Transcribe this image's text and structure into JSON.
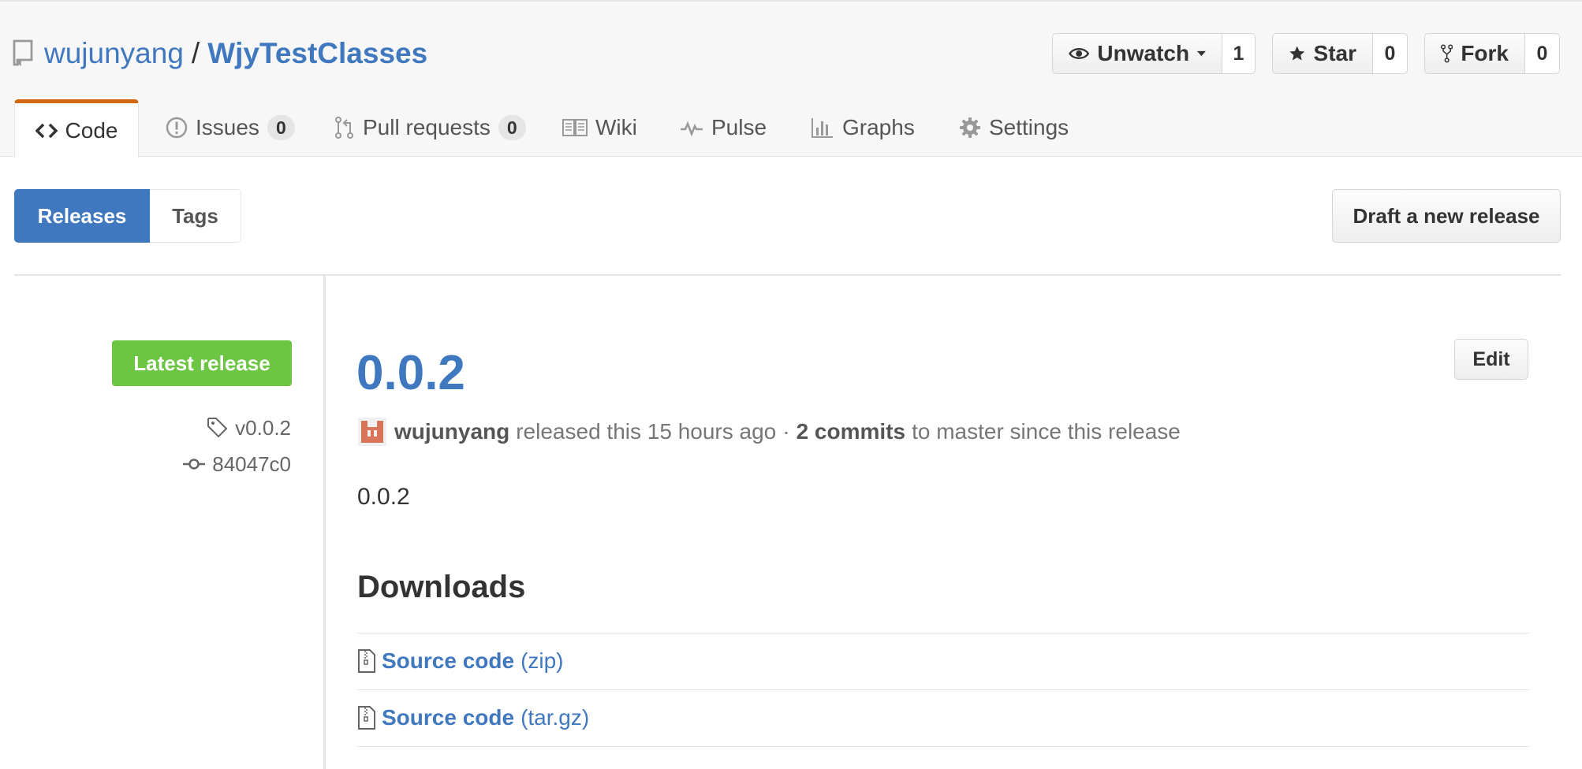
{
  "repo": {
    "owner": "wujunyang",
    "separator": "/",
    "name": "WjyTestClasses"
  },
  "actions": {
    "watch": {
      "label": "Unwatch",
      "count": "1"
    },
    "star": {
      "label": "Star",
      "count": "0"
    },
    "fork": {
      "label": "Fork",
      "count": "0"
    }
  },
  "tabs": [
    {
      "label": "Code",
      "icon": "code-icon",
      "selected": true
    },
    {
      "label": "Issues",
      "count": "0",
      "icon": "issue-icon"
    },
    {
      "label": "Pull requests",
      "count": "0",
      "icon": "pull-request-icon"
    },
    {
      "label": "Wiki",
      "icon": "book-icon"
    },
    {
      "label": "Pulse",
      "icon": "pulse-icon"
    },
    {
      "label": "Graphs",
      "icon": "graph-icon"
    },
    {
      "label": "Settings",
      "icon": "gear-icon"
    }
  ],
  "subnav": {
    "releases": "Releases",
    "tags": "Tags",
    "draft": "Draft a new release"
  },
  "release": {
    "badge": "Latest release",
    "tag": "v0.0.2",
    "commit": "84047c0",
    "title": "0.0.2",
    "edit": "Edit",
    "author": "wujunyang",
    "released_text": "released this 15 hours ago",
    "dot": "·",
    "commits": "2 commits",
    "since_text": "to master since this release",
    "body": "0.0.2"
  },
  "downloads": {
    "heading": "Downloads",
    "items": [
      {
        "label": "Source code",
        "format": "(zip)"
      },
      {
        "label": "Source code",
        "format": "(tar.gz)"
      }
    ]
  },
  "colors": {
    "link": "#4078c0",
    "latest": "#6cc644",
    "tab_accent": "#d26911",
    "releases_active": "#4078c0"
  }
}
